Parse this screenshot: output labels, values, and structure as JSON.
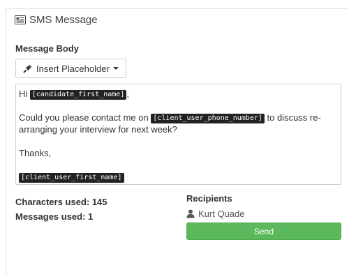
{
  "header": {
    "title": "SMS Message",
    "icon": "newspaper-icon"
  },
  "message_body": {
    "label": "Message Body",
    "insert_button_label": "Insert Placeholder",
    "insert_button_icon": "plug-icon",
    "line1_prefix": "Hi ",
    "line1_placeholder": "[candidate_first_name]",
    "line1_suffix": ",",
    "line2_prefix": "Could you please contact me on ",
    "line2_placeholder": "[client_user_phone_number]",
    "line2_suffix": " to discuss re-arranging your interview for next week?",
    "line3": "Thanks,",
    "line4_placeholder": "[client_user_first_name]"
  },
  "stats": {
    "characters_label": "Characters used: 145",
    "messages_label": "Messages used: 1"
  },
  "recipients": {
    "title": "Recipients",
    "items": [
      {
        "name": "Kurt Quade",
        "icon": "user-icon"
      }
    ]
  },
  "send_button_label": "Send",
  "colors": {
    "send_button": "#5cb85c",
    "placeholder_bg": "#222222",
    "text": "#333333"
  }
}
